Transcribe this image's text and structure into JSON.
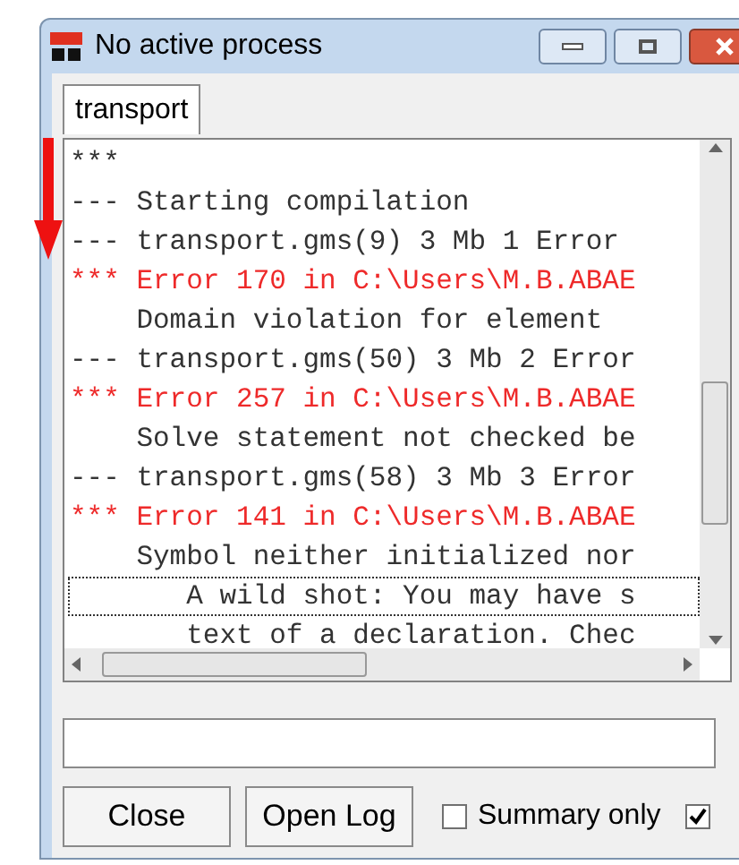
{
  "window": {
    "title": "No active process"
  },
  "tabs": [
    {
      "label": "transport",
      "selected": true
    }
  ],
  "log": {
    "lines": [
      {
        "kind": "normal",
        "text": "***",
        "focused": false
      },
      {
        "kind": "normal",
        "text": "--- Starting compilation",
        "focused": false
      },
      {
        "kind": "normal",
        "text": "--- transport.gms(9) 3 Mb 1 Error",
        "focused": false
      },
      {
        "kind": "error",
        "text": "*** Error 170 in C:\\Users\\M.B.ABAE",
        "focused": false
      },
      {
        "kind": "normal",
        "text": "    Domain violation for element",
        "focused": false
      },
      {
        "kind": "normal",
        "text": "--- transport.gms(50) 3 Mb 2 Error",
        "focused": false
      },
      {
        "kind": "error",
        "text": "*** Error 257 in C:\\Users\\M.B.ABAE",
        "focused": false
      },
      {
        "kind": "normal",
        "text": "    Solve statement not checked be",
        "focused": false
      },
      {
        "kind": "normal",
        "text": "--- transport.gms(58) 3 Mb 3 Error",
        "focused": false
      },
      {
        "kind": "error",
        "text": "*** Error 141 in C:\\Users\\M.B.ABAE",
        "focused": false
      },
      {
        "kind": "normal",
        "text": "    Symbol neither initialized nor",
        "focused": false
      },
      {
        "kind": "normal",
        "text": "       A wild shot: You may have s",
        "focused": true
      },
      {
        "kind": "normal",
        "text": "       text of a declaration. Chec",
        "focused": false
      }
    ]
  },
  "buttons": [
    "Close",
    "Open Log"
  ],
  "checkboxes": [
    {
      "label": "Summary only",
      "checked": false
    },
    {
      "checked": true
    }
  ]
}
